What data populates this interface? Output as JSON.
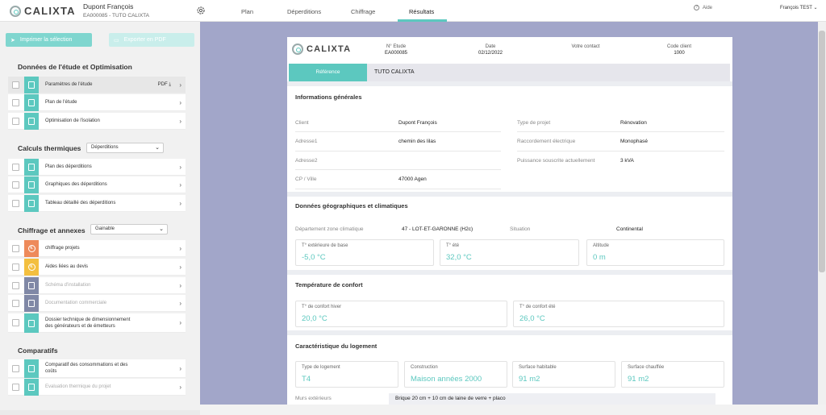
{
  "app": {
    "logo": "CALIXTA",
    "user_name": "Dupont François",
    "project_line": "EA000085 - TUTO CALIXTA",
    "help": "Aide",
    "account": "François TEST"
  },
  "tabs": [
    {
      "label": "Plan"
    },
    {
      "label": "Déperditions"
    },
    {
      "label": "Chiffrage"
    },
    {
      "label": "Résultats"
    }
  ],
  "sidebar": {
    "print_button": "Imprimer la sélection",
    "export_button": "Exporter en PDF",
    "s1_title": "Données de l'étude et Optimisation",
    "s1_items": [
      {
        "label": "Paramètres de l'étude",
        "pdf": "PDF"
      },
      {
        "label": "Plan de l'étude"
      },
      {
        "label": "Optimisation de l'isolation"
      }
    ],
    "s2_title": "Calculs thermiques",
    "s2_select": "Déperditions",
    "s2_items": [
      {
        "label": "Plan des déperditions"
      },
      {
        "label": "Graphiques des déperditions"
      },
      {
        "label": "Tableau détaillé des déperditions"
      }
    ],
    "s3_title": "Chiffrage et annexes",
    "s3_select": "Gainable",
    "s3_items": [
      {
        "label": "chiffrage projets"
      },
      {
        "label": "Aides liées au devis"
      },
      {
        "label": "Schéma d'installation"
      },
      {
        "label": "Documentation commerciale"
      },
      {
        "label": "Dossier technique de dimensionnement",
        "label2": "des générateurs et de émetteurs"
      }
    ],
    "s4_title": "Comparatifs",
    "s4_items": [
      {
        "label": "Comparatif des consommations et des",
        "label2": "coûts"
      },
      {
        "label": "Evaluation thermique du projet"
      }
    ]
  },
  "doc": {
    "logo": "CALIXTA",
    "header": [
      {
        "label": "N° Etude",
        "value": "EA000085"
      },
      {
        "label": "Date",
        "value": "02/12/2022"
      },
      {
        "label": "Votre contact",
        "value": ""
      },
      {
        "label": "Code client",
        "value": "1000"
      }
    ],
    "ref_tab": "Référence",
    "ref_value": "TUTO CALIXTA",
    "general": {
      "title": "Informations générales",
      "left": [
        {
          "label": "Client",
          "value": "Dupont François"
        },
        {
          "label": "Adresse1",
          "value": "chemin des lilas"
        },
        {
          "label": "Adresse2",
          "value": ""
        },
        {
          "label": "CP / Ville",
          "value": "47000  Agen"
        }
      ],
      "right": [
        {
          "label": "Type de projet",
          "value": "Rénovation"
        },
        {
          "label": "Raccordement électrique",
          "value": "Monophasé"
        },
        {
          "label": "Puissance souscrite actuellement",
          "value": "3 kVA"
        }
      ]
    },
    "geo": {
      "title": "Données géographiques et climatiques",
      "dept_label": "Département zone climatique",
      "dept_value": "47 - LOT-ET-GARONNE (H2c)",
      "situation_label": "Situation",
      "situation_value": "Continental",
      "cards": [
        {
          "label": "T° extérieure de base",
          "value": "-5,0 °C"
        },
        {
          "label": "T° été",
          "value": "32,0 °C"
        },
        {
          "label": "Altitude",
          "value": "0 m"
        }
      ]
    },
    "comfort": {
      "title": "Température de confort",
      "cards": [
        {
          "label": "T° de confort hiver",
          "value": "20,0 °C"
        },
        {
          "label": "T° de confort été",
          "value": "26,0 °C"
        }
      ]
    },
    "housing": {
      "title": "Caractéristique du logement",
      "cards": [
        {
          "label": "Type de logement",
          "value": "T4"
        },
        {
          "label": "Construction",
          "value": "Maison années 2000"
        },
        {
          "label": "Surface habitable",
          "value": "91 m2"
        },
        {
          "label": "Surface chauffée",
          "value": "91 m2"
        }
      ],
      "murs_label": "Murs extérieurs",
      "murs_value": "Brique 20 cm + 10 cm de laine de verre + placo"
    }
  },
  "colors": {
    "accent": "#5cc8bf",
    "doc_background": "#a2a6c9",
    "icon_teal": "#5cc8bf",
    "icon_orange": "#ee8a5a",
    "icon_yellow": "#f3bf3f",
    "icon_slate": "#8088a6"
  }
}
